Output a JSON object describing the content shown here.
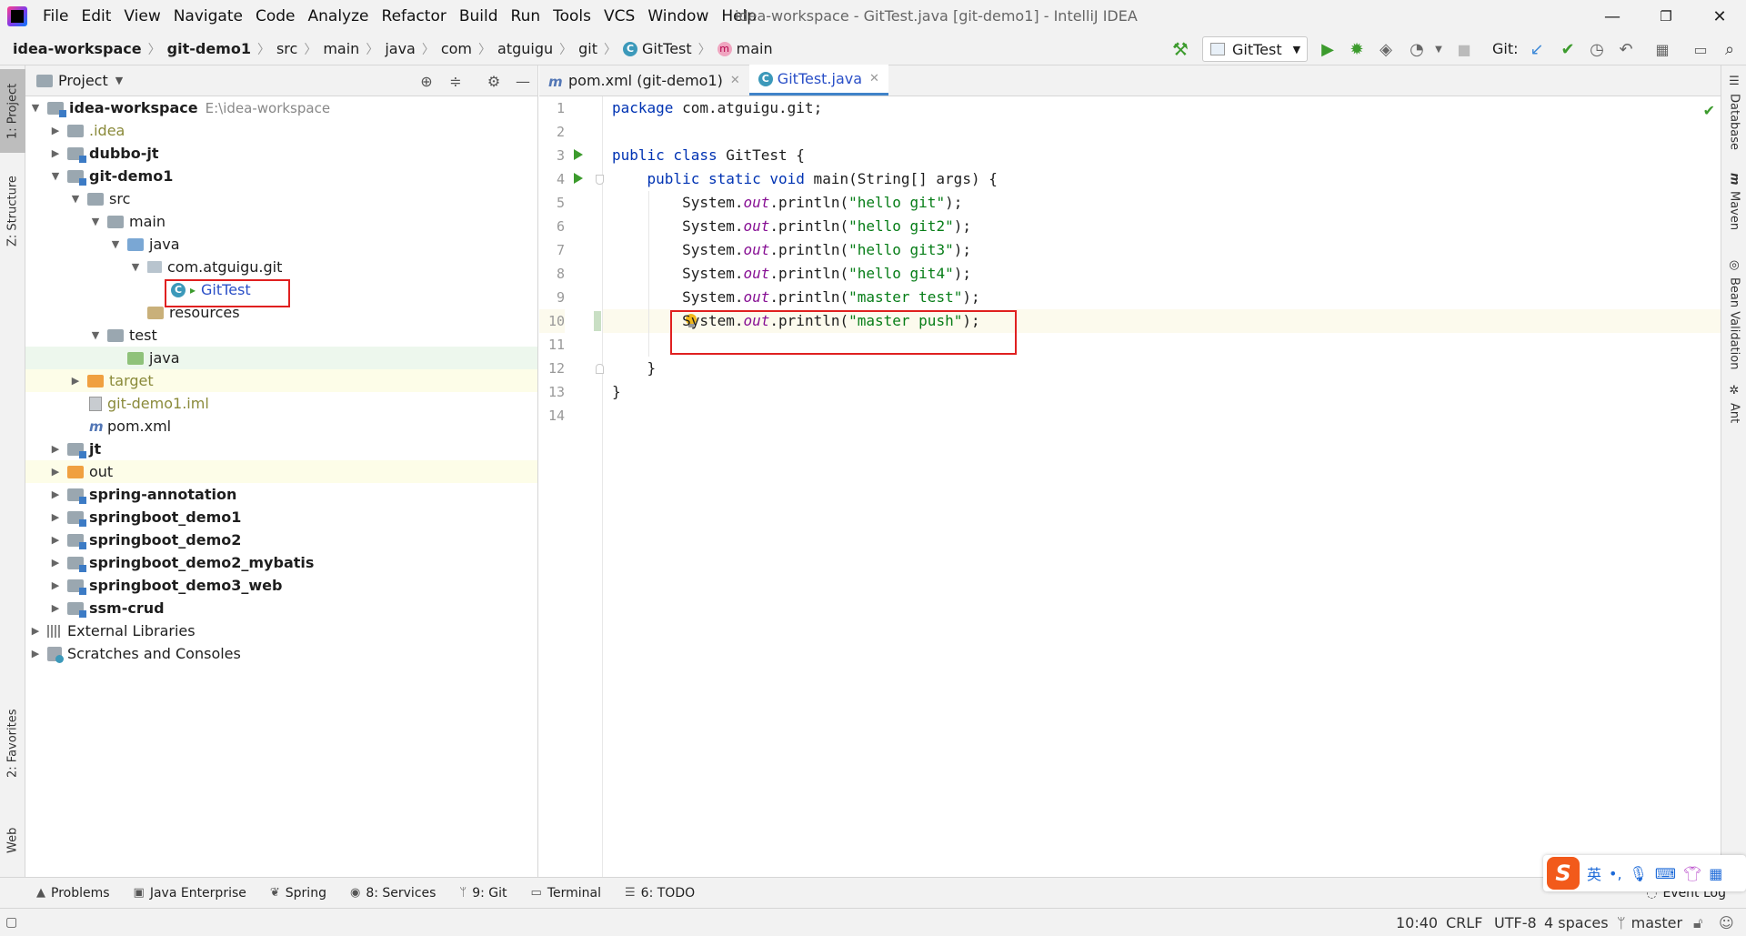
{
  "menubar": {
    "items": [
      "File",
      "Edit",
      "View",
      "Navigate",
      "Code",
      "Analyze",
      "Refactor",
      "Build",
      "Run",
      "Tools",
      "VCS",
      "Window",
      "Help"
    ],
    "window_title": "idea-workspace - GitTest.java [git-demo1] - IntelliJ IDEA",
    "minimize": "—",
    "restore": "❐",
    "close": "✕"
  },
  "navbar": {
    "breadcrumbs": [
      "idea-workspace",
      "git-demo1",
      "src",
      "main",
      "java",
      "com",
      "atguigu",
      "git",
      "GitTest",
      "main"
    ],
    "run_config": "GitTest",
    "git_label": "Git:"
  },
  "left_stripe": {
    "project_tab": "1: Project",
    "structure_tab": "Z: Structure",
    "favorites_tab": "2: Favorites",
    "web_tab": "Web"
  },
  "right_stripe": {
    "database": "Database",
    "maven": "Maven",
    "bean_validation": "Bean Validation",
    "ant": "Ant"
  },
  "project_panel": {
    "title": "Project",
    "tree": [
      {
        "label": "idea-workspace",
        "extra": "E:\\idea-workspace"
      },
      {
        "label": ".idea"
      },
      {
        "label": "dubbo-jt"
      },
      {
        "label": "git-demo1"
      },
      {
        "label": "src"
      },
      {
        "label": "main"
      },
      {
        "label": "java"
      },
      {
        "label": "com.atguigu.git"
      },
      {
        "label": "GitTest"
      },
      {
        "label": "resources"
      },
      {
        "label": "test"
      },
      {
        "label": "java"
      },
      {
        "label": "target"
      },
      {
        "label": "git-demo1.iml"
      },
      {
        "label": "pom.xml"
      },
      {
        "label": "jt"
      },
      {
        "label": "out"
      },
      {
        "label": "spring-annotation"
      },
      {
        "label": "springboot_demo1"
      },
      {
        "label": "springboot_demo2"
      },
      {
        "label": "springboot_demo2_mybatis"
      },
      {
        "label": "springboot_demo3_web"
      },
      {
        "label": "ssm-crud"
      },
      {
        "label": "External Libraries"
      },
      {
        "label": "Scratches and Consoles"
      }
    ]
  },
  "editor": {
    "tabs": [
      {
        "label": "pom.xml (git-demo1)"
      },
      {
        "label": "GitTest.java"
      }
    ],
    "line_numbers": [
      "1",
      "2",
      "3",
      "4",
      "5",
      "6",
      "7",
      "8",
      "9",
      "10",
      "11",
      "12",
      "13",
      "14"
    ],
    "code": {
      "l1_kw": "package",
      "l1_rest": " com.atguigu.git;",
      "l3_kw": "public class",
      "l3_rest": " GitTest {",
      "l4_indent": "    ",
      "l4_kw": "public static void",
      "l4_rest": " main(String[] args) {",
      "indent8": "        ",
      "sys": "System.",
      "out": "out",
      "println_open": ".println(",
      "close": ");",
      "s5": "\"hello git\"",
      "s6": "\"hello git2\"",
      "s7": "\"hello git3\"",
      "s8": "\"hello git4\"",
      "s9": "\"master test\"",
      "s10": "\"master push\"",
      "l12": "    }",
      "l13": "}"
    }
  },
  "bottom_bar": {
    "tabs": [
      "Problems",
      "Java Enterprise",
      "Spring",
      "8: Services",
      "9: Git",
      "Terminal",
      "6: TODO"
    ],
    "event_log": "Event Log"
  },
  "status_bar": {
    "position": "10:40",
    "line_sep": "CRLF",
    "encoding": "UTF-8",
    "indent": "4 spaces",
    "branch": "master"
  },
  "ime": {
    "logo": "S",
    "lang": "英",
    "punct": "•,"
  },
  "colors": {
    "keyword": "#0033b3",
    "string": "#067d17",
    "static_field": "#871094",
    "highlight_box": "#e02020",
    "run_green": "#3c9b2d"
  }
}
